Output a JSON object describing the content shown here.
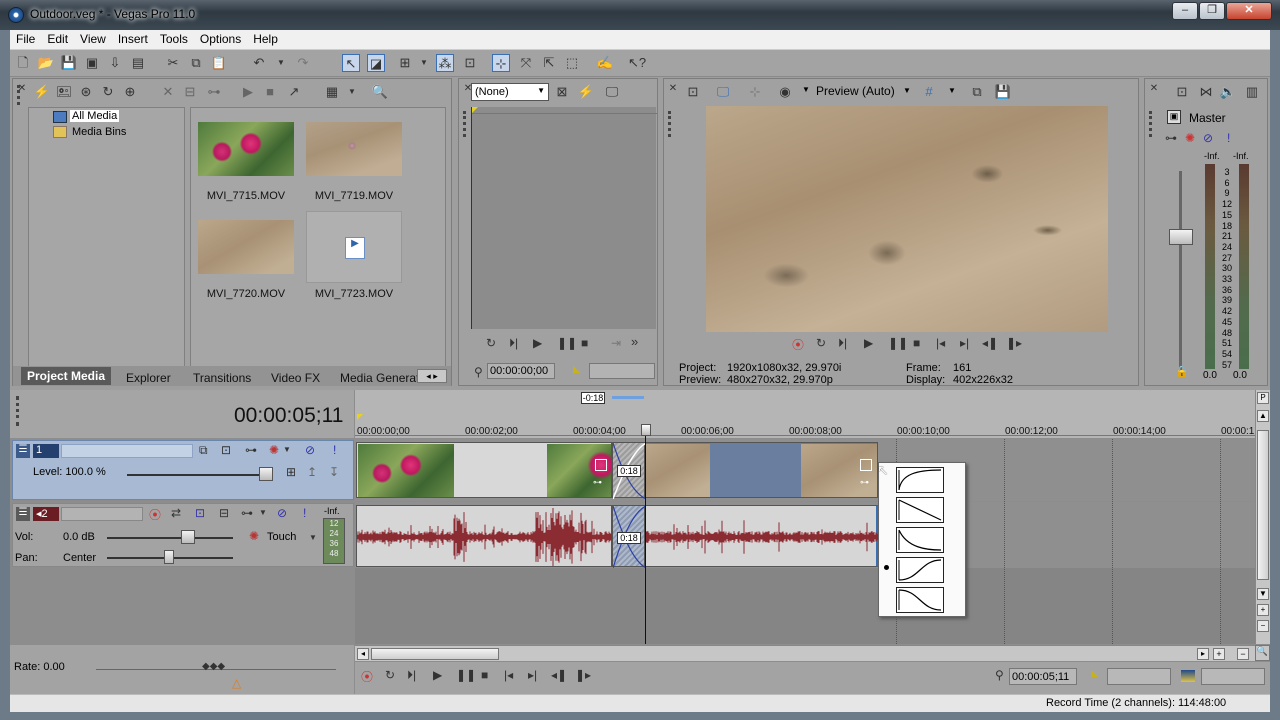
{
  "window": {
    "title": "Outdoor.veg * - Vegas Pro 11.0",
    "min": "–",
    "max": "❐",
    "close": "✕"
  },
  "menu": [
    "File",
    "Edit",
    "View",
    "Insert",
    "Tools",
    "Options",
    "Help"
  ],
  "explorer": {
    "tree": [
      "All Media",
      "Media Bins"
    ],
    "media": [
      {
        "name": "MVI_7715.MOV"
      },
      {
        "name": "MVI_7719.MOV"
      },
      {
        "name": "MVI_7720.MOV"
      },
      {
        "name": "MVI_7723.MOV"
      }
    ],
    "tabs": [
      "Project Media",
      "Explorer",
      "Transitions",
      "Video FX",
      "Media Generat"
    ]
  },
  "trimmer": {
    "preset": "(None)",
    "timecode": "00:00:00;00"
  },
  "preview": {
    "mode": "Preview (Auto)",
    "project_label": "Project:",
    "project_value": "1920x1080x32, 29.970i",
    "preview_label": "Preview:",
    "preview_value": "480x270x32, 29.970p",
    "frame_label": "Frame:",
    "frame_value": "161",
    "display_label": "Display:",
    "display_value": "402x226x32"
  },
  "master": {
    "title": "Master",
    "inf_l": "-Inf.",
    "inf_r": "-Inf.",
    "scale": [
      "3",
      "6",
      "9",
      "12",
      "15",
      "18",
      "21",
      "24",
      "27",
      "30",
      "33",
      "36",
      "39",
      "42",
      "45",
      "48",
      "51",
      "54",
      "57"
    ],
    "out_l": "0.0",
    "out_r": "0.0"
  },
  "timeline": {
    "cursor_time": "00:00:05;11",
    "selection_len": "-0:18",
    "ticks": [
      "00:00:00;00",
      "00:00:02;00",
      "00:00:04;00",
      "00:00:06;00",
      "00:00:08;00",
      "00:00:10;00",
      "00:00:12;00",
      "00:00:14;00",
      "00:00:1"
    ],
    "fade_label": "0:18",
    "fade_label_audio": "0:18"
  },
  "track1": {
    "num": "1",
    "level_label": "Level: 100.0 %"
  },
  "track2": {
    "num": "2",
    "vol_label": "Vol:",
    "vol_value": "0.0 dB",
    "pan_label": "Pan:",
    "pan_value": "Center",
    "mode": "Touch",
    "meter_top": "-Inf.",
    "meter_vals": [
      "12",
      "24",
      "36",
      "48"
    ]
  },
  "rate": "Rate: 0.00",
  "transport_time": "00:00:05;11",
  "status": {
    "record_time": "Record Time (2 channels): 114:48:00"
  },
  "fade_popup": {
    "selected_index": 3,
    "curve_count": 5
  },
  "colors": {
    "track_header": "#a7b9d3",
    "audio_wave": "#8b2b32",
    "selection": "#6a7ea0",
    "accent": "#3b6fb3"
  }
}
